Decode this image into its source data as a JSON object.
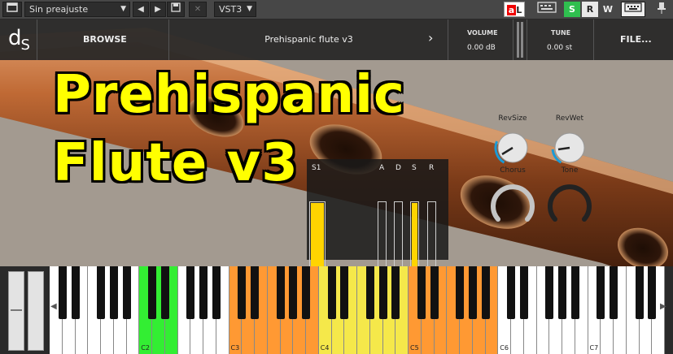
{
  "host": {
    "preset_value": "Sin preajuste",
    "prev_label": "◀",
    "next_label": "▶",
    "format_value": "VST3",
    "s_label": "S",
    "r_label": "R",
    "w_label": "W",
    "al_label": "a",
    "al_label2": "L"
  },
  "header": {
    "logo_d": "d",
    "logo_s": "S",
    "browse_label": "BROWSE",
    "preset_name": "Prehispanic flute v3",
    "volume_label": "VOLUME",
    "volume_value": "0.00 dB",
    "tune_label": "TUNE",
    "tune_value": "0.00 st",
    "file_label": "FILE..."
  },
  "title": {
    "line1": "Prehispanic",
    "line2": "Flute v3"
  },
  "envelope": {
    "s1_label": "S1",
    "a_label": "A",
    "d_label": "D",
    "s_label": "S",
    "r_label": "R",
    "s1_level": 1.0,
    "a_level": 0.0,
    "d_level": 0.0,
    "s_level": 1.0,
    "r_level": 0.05
  },
  "knobs": {
    "revsize_label": "RevSize",
    "revwet_label": "RevWet",
    "chorus_label": "Chorus",
    "tone_label": "Tone"
  },
  "keyboard": {
    "octave_labels": [
      "C2",
      "C3",
      "C4",
      "C5",
      "C6",
      "C7"
    ],
    "colors": {
      "green": "#33ee33",
      "orange": "#ff9933",
      "yellow": "#f5e84a",
      "white": "#ffffff"
    }
  }
}
